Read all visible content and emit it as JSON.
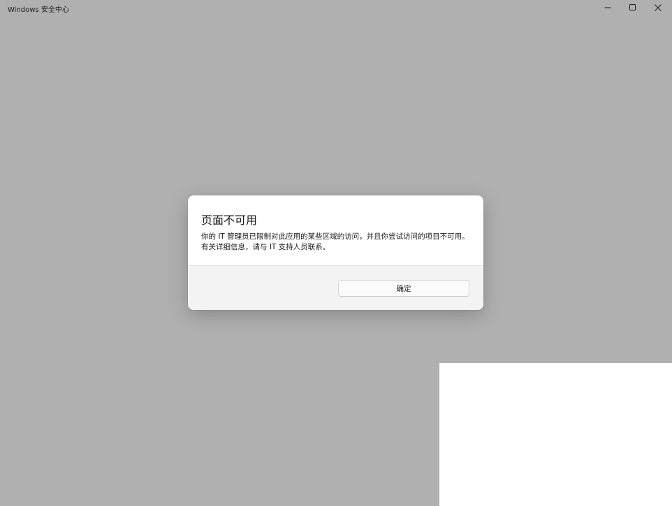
{
  "window": {
    "title": "Windows 安全中心",
    "controls": {
      "minimize_icon": "minimize-icon",
      "maximize_icon": "maximize-icon",
      "close_icon": "close-icon"
    }
  },
  "dialog": {
    "title": "页面不可用",
    "message": "你的 IT 管理员已限制对此应用的某些区域的访问，并且你尝试访问的项目不可用。有关详细信息，请与 IT 支持人员联系。",
    "ok_label": "确定"
  },
  "colors": {
    "backdrop": "#b0b0b0",
    "dialog_bg": "#ffffff",
    "footer_bg": "#f3f3f3",
    "button_bg": "#fbfbfb"
  }
}
